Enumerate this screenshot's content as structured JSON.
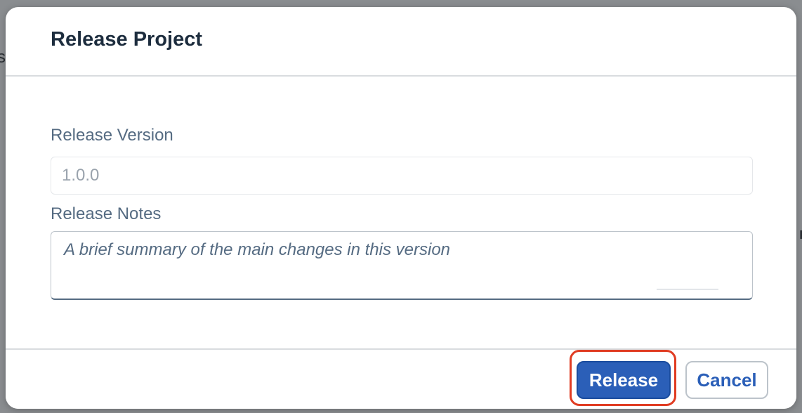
{
  "dialog": {
    "title": "Release Project",
    "fields": {
      "version_label": "Release Version",
      "version_value": "",
      "version_placeholder": "1.0.0",
      "notes_label": "Release Notes",
      "notes_value": "",
      "notes_placeholder": "A brief summary of the main changes in this version"
    },
    "footer": {
      "release_label": "Release",
      "cancel_label": "Cancel"
    }
  },
  "colors": {
    "primary": "#2b5fb8",
    "title_text": "#1d2d3e",
    "label_text": "#556b82",
    "highlight": "#e03c22"
  }
}
